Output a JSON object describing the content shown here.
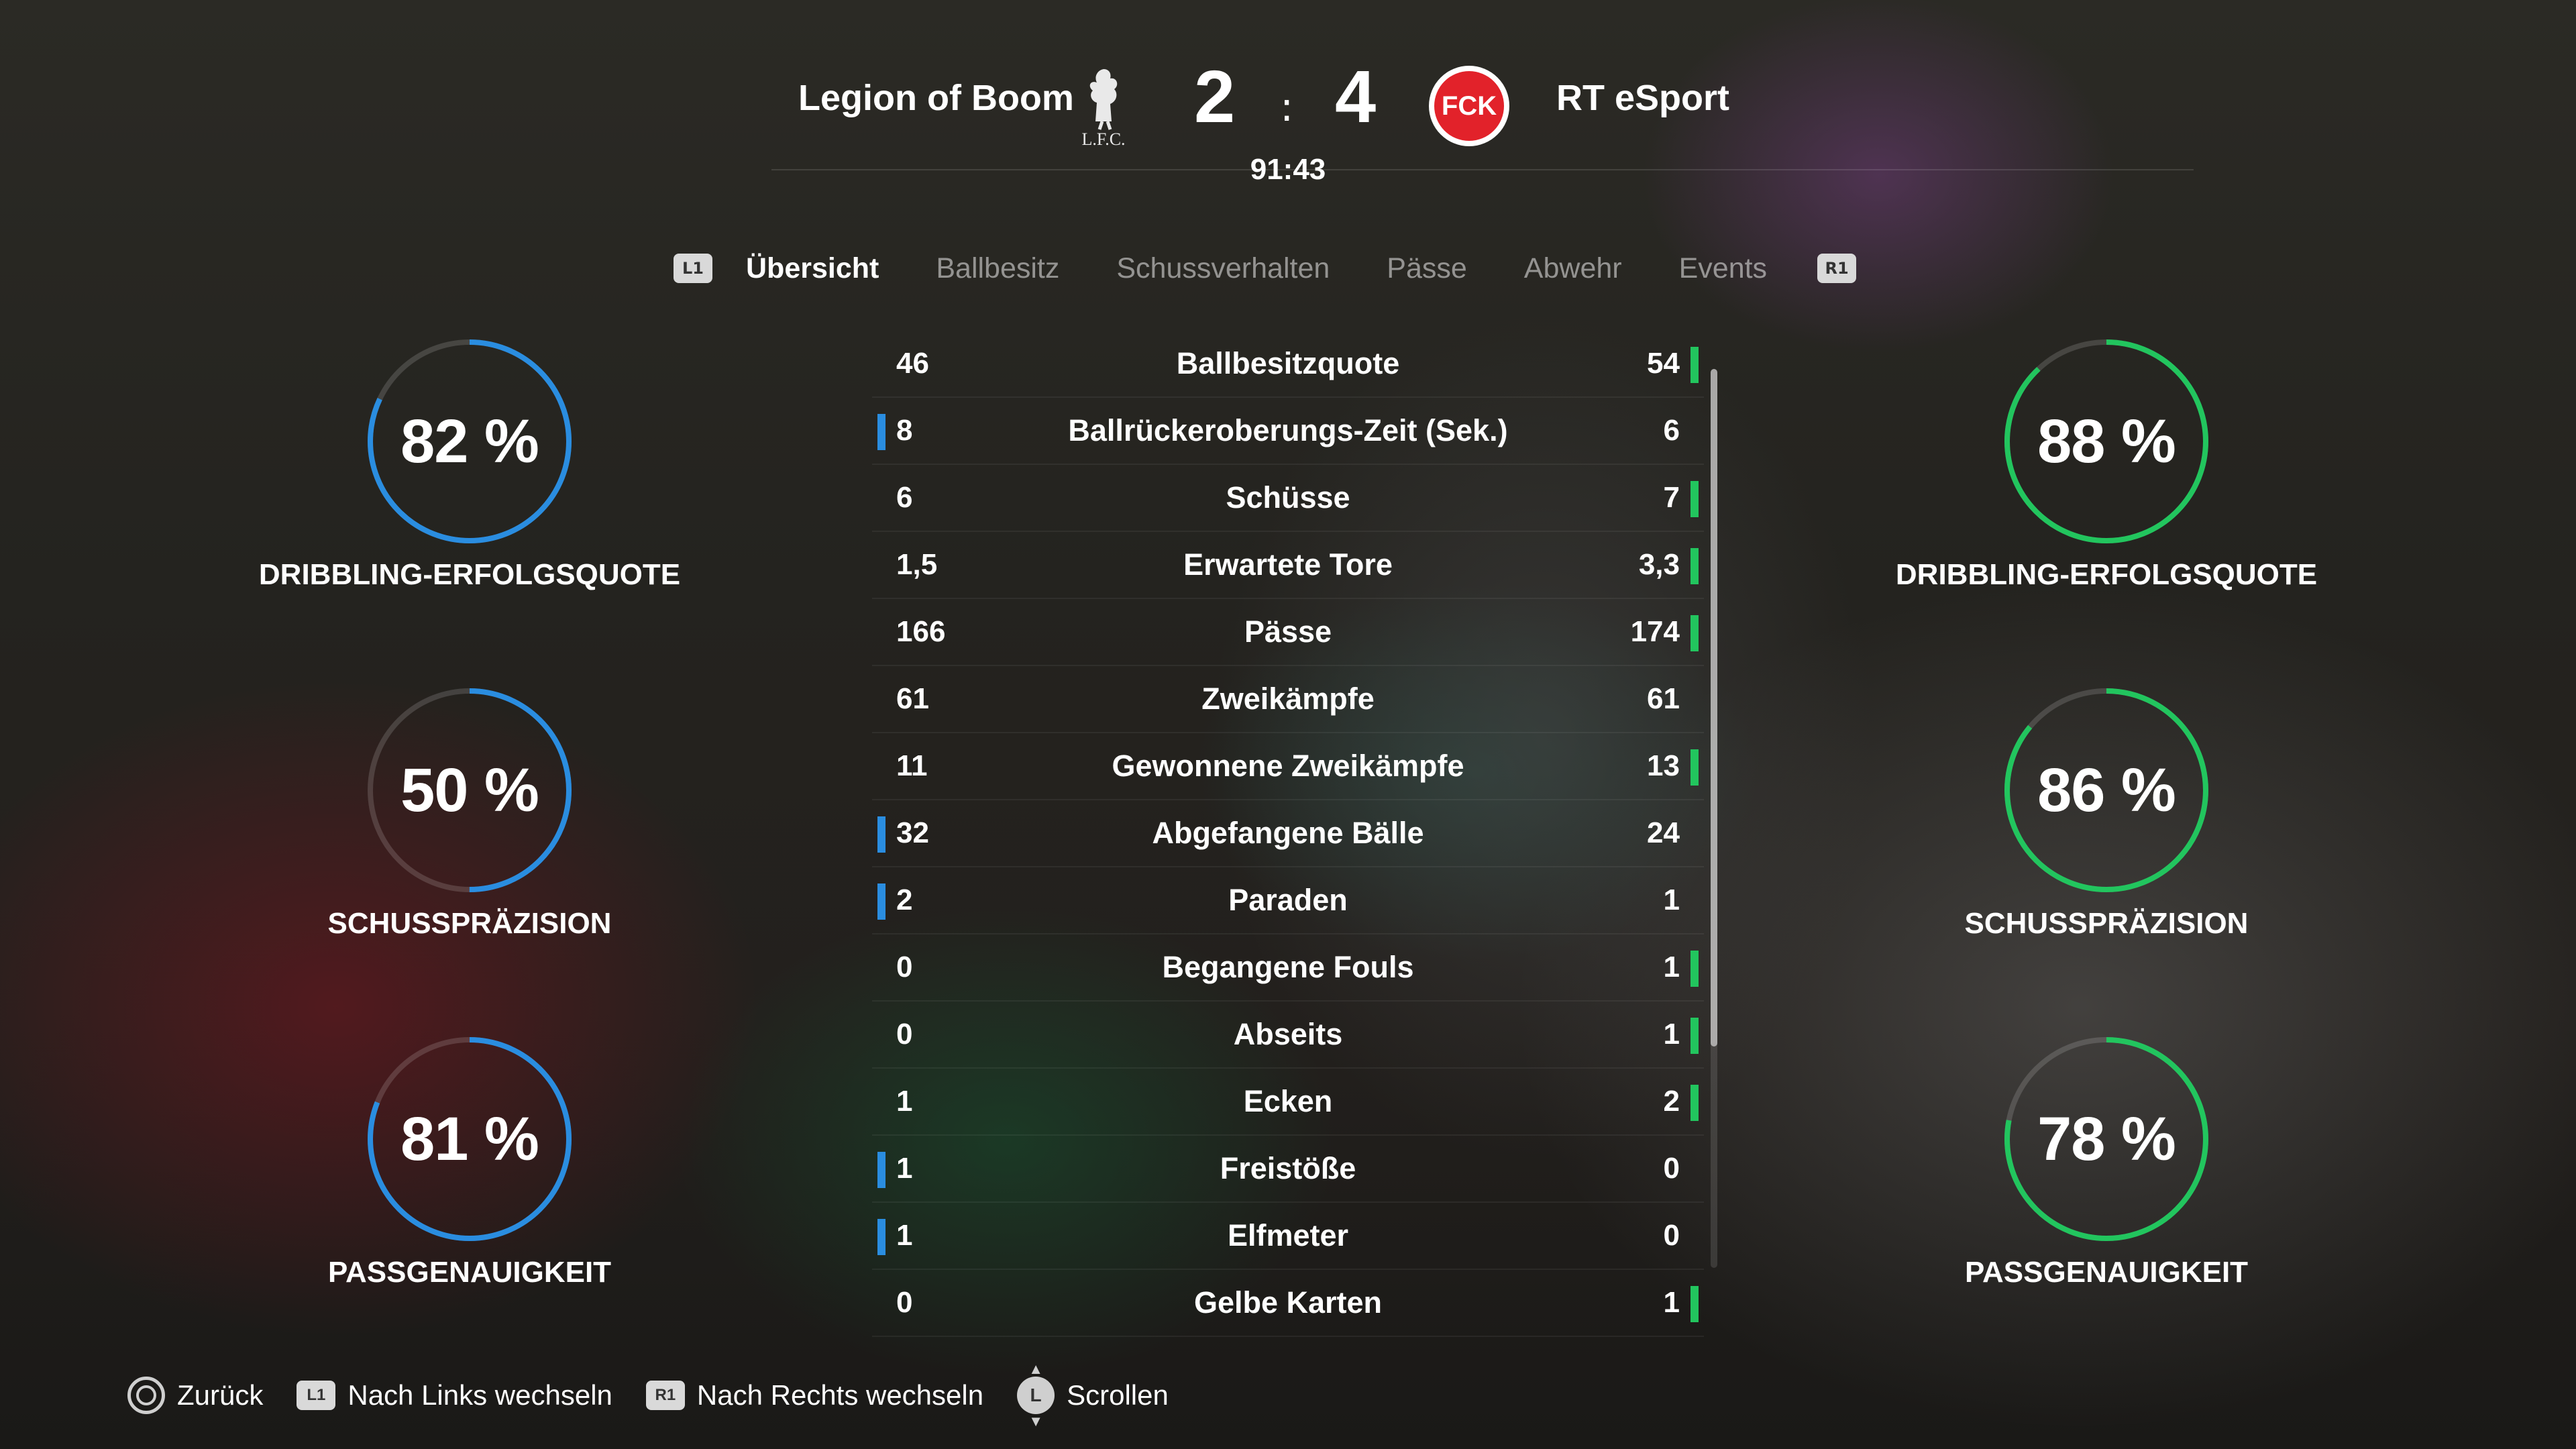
{
  "scoreboard": {
    "home_team": "Legion of Boom",
    "away_team": "RT eSport",
    "home_score": "2",
    "away_score": "4",
    "separator": ":",
    "clock": "91:43",
    "home_logo_text": "L.F.C.",
    "away_logo_text": "FCK"
  },
  "tabs": {
    "left_button": "L1",
    "right_button": "R1",
    "items": [
      "Übersicht",
      "Ballbesitz",
      "Schussverhalten",
      "Pässe",
      "Abwehr",
      "Events"
    ],
    "active": "Übersicht"
  },
  "left_rings": [
    {
      "value": "82 %",
      "percent": 82,
      "label": "DRIBBLING-ERFOLGSQUOTE"
    },
    {
      "value": "50 %",
      "percent": 50,
      "label": "SCHUSSPRÄZISION"
    },
    {
      "value": "81 %",
      "percent": 81,
      "label": "PASSGENAUIGKEIT"
    }
  ],
  "right_rings": [
    {
      "value": "88 %",
      "percent": 88,
      "label": "DRIBBLING-ERFOLGSQUOTE"
    },
    {
      "value": "86 %",
      "percent": 86,
      "label": "SCHUSSPRÄZISION"
    },
    {
      "value": "78 %",
      "percent": 78,
      "label": "PASSGENAUIGKEIT"
    }
  ],
  "stats": [
    {
      "name": "Ballbesitzquote",
      "home": "46",
      "away": "54",
      "leader": "away"
    },
    {
      "name": "Ballrückeroberungs-Zeit (Sek.)",
      "home": "8",
      "away": "6",
      "leader": "home"
    },
    {
      "name": "Schüsse",
      "home": "6",
      "away": "7",
      "leader": "away"
    },
    {
      "name": "Erwartete Tore",
      "home": "1,5",
      "away": "3,3",
      "leader": "away"
    },
    {
      "name": "Pässe",
      "home": "166",
      "away": "174",
      "leader": "away"
    },
    {
      "name": "Zweikämpfe",
      "home": "61",
      "away": "61",
      "leader": "none"
    },
    {
      "name": "Gewonnene Zweikämpfe",
      "home": "11",
      "away": "13",
      "leader": "away"
    },
    {
      "name": "Abgefangene Bälle",
      "home": "32",
      "away": "24",
      "leader": "home"
    },
    {
      "name": "Paraden",
      "home": "2",
      "away": "1",
      "leader": "home"
    },
    {
      "name": "Begangene Fouls",
      "home": "0",
      "away": "1",
      "leader": "away"
    },
    {
      "name": "Abseits",
      "home": "0",
      "away": "1",
      "leader": "away"
    },
    {
      "name": "Ecken",
      "home": "1",
      "away": "2",
      "leader": "away"
    },
    {
      "name": "Freistöße",
      "home": "1",
      "away": "0",
      "leader": "home"
    },
    {
      "name": "Elfmeter",
      "home": "1",
      "away": "0",
      "leader": "home"
    },
    {
      "name": "Gelbe Karten",
      "home": "0",
      "away": "1",
      "leader": "away"
    }
  ],
  "footer": {
    "back": "Zurück",
    "l1_badge": "L1",
    "left_switch": "Nach Links wechseln",
    "r1_badge": "R1",
    "right_switch": "Nach Rechts wechseln",
    "stick_badge": "L",
    "scroll": "Scrollen"
  },
  "colors": {
    "home": "#2a8de0",
    "away": "#22c55e",
    "ring_track": "rgba(255,255,255,0.15)",
    "away_logo_red": "#e2222a"
  }
}
